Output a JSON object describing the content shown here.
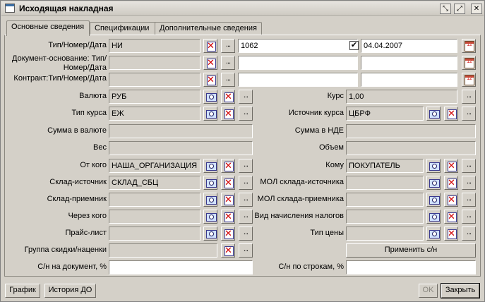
{
  "window": {
    "title": "Исходящая накладная"
  },
  "titlebar_buttons": [
    "restore-icon",
    "maximize-icon",
    "close-icon"
  ],
  "tabs": [
    {
      "label": "Основные сведения",
      "active": true
    },
    {
      "label": "Спецификации",
      "active": false
    },
    {
      "label": "Дополнительные сведения",
      "active": false
    }
  ],
  "labels": {
    "type_num_date": "Тип/Номер/Дата",
    "base_doc": "Документ-основание: Тип/Номер/Дата",
    "contract": "Контракт:Тип/Номер/Дата",
    "currency": "Валюта",
    "rate": "Курс",
    "rate_type": "Тип курса",
    "rate_source": "Источник курса",
    "sum_currency": "Сумма в валюте",
    "sum_nde": "Сумма в НДЕ",
    "weight": "Вес",
    "volume": "Объем",
    "from": "От кого",
    "to": "Кому",
    "wh_source": "Склад-источник",
    "mol_source": "МОЛ склада-источника",
    "wh_target": "Склад-приемник",
    "mol_target": "МОЛ склада-приемника",
    "via": "Через кого",
    "tax_type": "Вид начисления налогов",
    "price_list": "Прайс-лист",
    "price_type": "Тип цены",
    "discount_group": "Группа скидки/наценки",
    "sn_doc": "С/н на документ, %",
    "sn_lines": "С/н по строкам, %"
  },
  "values": {
    "doc_type": "НИ",
    "doc_number": "1062",
    "doc_date": "04.04.2007",
    "date_checked": "✔",
    "currency": "РУБ",
    "rate": "1,00",
    "rate_type": "ЕЖ",
    "rate_source": "ЦБРФ",
    "from": "НАША_ОРГАНИЗАЦИЯ",
    "to": "ПОКУПАТЕЛЬ",
    "wh_source": "СКЛАД_СБЦ",
    "calendar_glyph": "12"
  },
  "buttons": {
    "dots": "...",
    "apply_sn": "Применить с/н",
    "chart": "График",
    "history": "История ДО",
    "ok": "OK",
    "close": "Закрыть"
  }
}
